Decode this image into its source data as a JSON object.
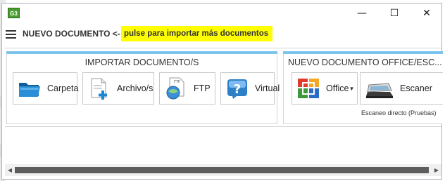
{
  "window": {
    "app_icon_text": "G3",
    "minimize_glyph": "—",
    "maximize_glyph": "☐",
    "close_glyph": "✕"
  },
  "header": {
    "title": "NUEVO DOCUMENTO <-",
    "hint": "pulse para importar más documentos"
  },
  "groups": {
    "import": {
      "title": "IMPORTAR DOCUMENTO/S",
      "buttons": [
        {
          "label": "Carpeta",
          "icon": "folder-icon"
        },
        {
          "label": "Archivo/s",
          "icon": "add-file-icon"
        },
        {
          "label": "FTP",
          "icon": "ftp-globe-icon"
        },
        {
          "label": "Virtual",
          "icon": "virtual-question-icon"
        }
      ]
    },
    "office": {
      "title": "NUEVO DOCUMENTO OFFICE/ESC...",
      "office_label": "Office",
      "office_icon": "office-icon",
      "split_glyph": "▼",
      "scanner_label": "Escaner",
      "scanner_icon": "scanner-icon",
      "scanner_caption": "Escaneo directo (Pruebas)"
    }
  },
  "scrollbar": {
    "left_glyph": "◀",
    "right_glyph": "▶"
  },
  "colors": {
    "accent_line": "#7cc4ec",
    "hint_highlight": "#ffff00",
    "app_icon_green": "#4b9c32"
  }
}
